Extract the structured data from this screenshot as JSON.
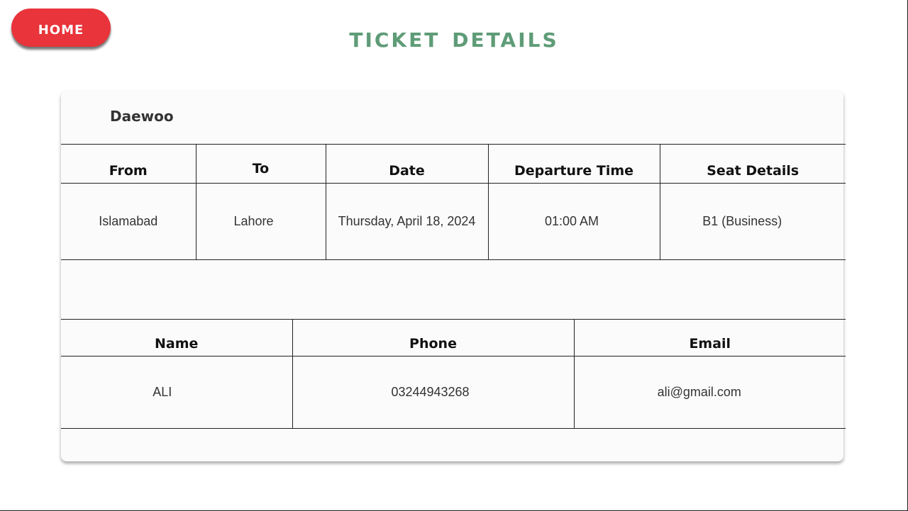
{
  "header": {
    "home_label": "Home",
    "title": "Ticket Details"
  },
  "ticket": {
    "company": "Daewoo",
    "trip_headers": [
      "From",
      "To",
      "Date",
      "Departure Time",
      "Seat Details"
    ],
    "trip_values": [
      "Islamabad",
      "Lahore",
      "Thursday, April 18, 2024",
      "01:00 AM",
      "B1 (Business)"
    ],
    "passenger_headers": [
      "Name",
      "Phone",
      "Email"
    ],
    "passenger_values": [
      "ALI",
      "03244943268",
      "ali@gmail.com"
    ]
  },
  "colors": {
    "home_button": "#e8343a",
    "title": "#5e9c77"
  }
}
